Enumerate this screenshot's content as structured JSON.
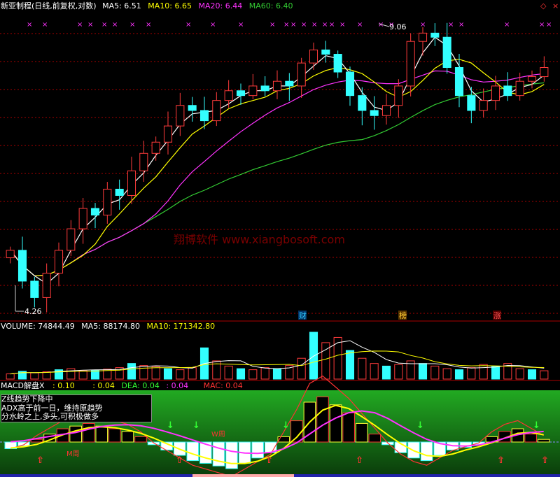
{
  "colors": {
    "up": "#ff3b3b",
    "down": "#33ffff",
    "ma5": "#ffffff",
    "ma10": "#ffff00",
    "ma20": "#ff33ff",
    "ma60": "#33cc33",
    "label": "#ffffff",
    "grid": "#aa0000",
    "green_bg": "#229922"
  },
  "main_header": {
    "title": "新亚制程(日线,前复权,对数)",
    "ma5": "MA5: 6.51",
    "ma10": "MA10: 6.65",
    "ma20": "MA20: 6.44",
    "ma60": "MA60: 6.40"
  },
  "price_annotations": {
    "high": "9.06",
    "low": "4.26"
  },
  "markers": [
    "财",
    "榜",
    "涨"
  ],
  "watermark": "翔博软件 www.xiangbosoft.com",
  "volume_header": {
    "vol": "VOLUME: 74844.49",
    "ma5": "MA5: 88174.80",
    "ma10": "MA10: 171342.80"
  },
  "macd_header": {
    "name": "MACD解盘X",
    "v1": ": 0.10",
    "v2": ": 0.04",
    "dea": "DEA: 0.04",
    "v3": ": 0.04",
    "mac": "MAC: 0.04"
  },
  "info_box": {
    "line1": "Z线趋势下降中",
    "line2": "ADX高于前一日，维持原趋势",
    "line3": "分水岭之上,多头,可积极做多"
  },
  "indicator_labels": {
    "m_week": "M周",
    "w_week": "W周"
  },
  "chart_data": {
    "type": "candlestick",
    "price_range": [
      4.2,
      9.3
    ],
    "log_scale": true,
    "close": [
      5.0,
      4.6,
      4.4,
      4.7,
      5.0,
      5.3,
      5.6,
      5.5,
      5.9,
      5.8,
      6.2,
      6.5,
      6.7,
      7.0,
      7.4,
      7.3,
      7.1,
      7.5,
      7.7,
      7.6,
      7.8,
      7.7,
      7.9,
      7.8,
      8.3,
      8.6,
      8.5,
      8.1,
      7.6,
      7.3,
      7.2,
      7.4,
      7.8,
      8.8,
      9.0,
      8.9,
      8.2,
      7.6,
      7.3,
      7.5,
      7.8,
      7.6,
      7.9,
      8.0,
      8.2
    ]
  },
  "volume_data": {
    "values": [
      10,
      15,
      12,
      14,
      18,
      20,
      16,
      17,
      19,
      22,
      30,
      26,
      24,
      20,
      18,
      22,
      60,
      35,
      25,
      20,
      18,
      22,
      20,
      26,
      40,
      90,
      70,
      80,
      55,
      40,
      30,
      25,
      28,
      35,
      30,
      25,
      20,
      18,
      22,
      28,
      25,
      30,
      20,
      18,
      16
    ]
  },
  "macd_data": {
    "values": [
      -5,
      -3,
      2,
      6,
      10,
      12,
      14,
      12,
      10,
      8,
      4,
      -2,
      -6,
      -10,
      -14,
      -16,
      -18,
      -20,
      -16,
      -12,
      -8,
      4,
      16,
      30,
      34,
      28,
      22,
      14,
      6,
      -2,
      -8,
      -12,
      -14,
      -10,
      -6,
      -4,
      -2,
      4,
      8,
      10,
      6,
      2
    ]
  }
}
